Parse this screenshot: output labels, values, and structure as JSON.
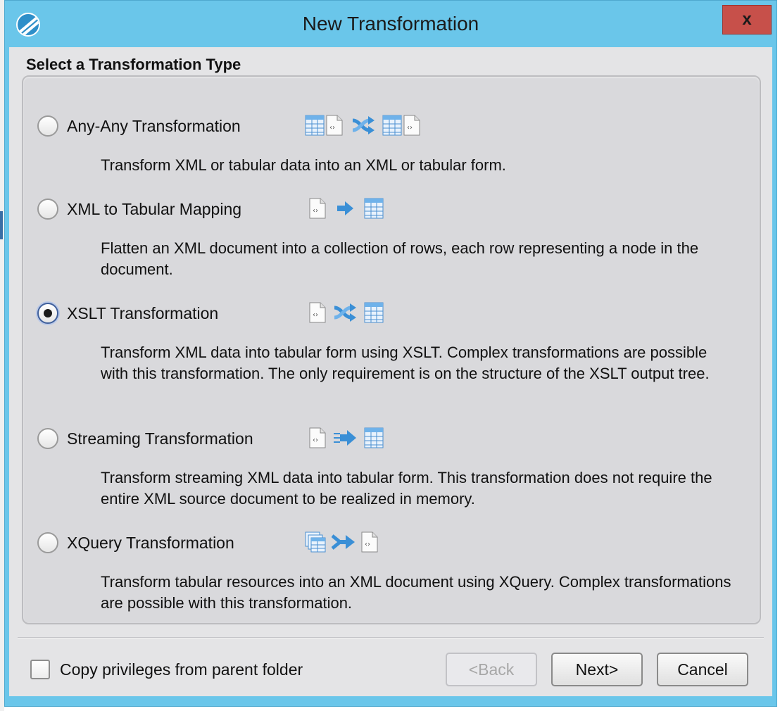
{
  "window": {
    "title": "New Transformation",
    "close_label": "x",
    "app_icon": "app-logo-icon"
  },
  "section": {
    "title": "Select a Transformation Type"
  },
  "options": [
    {
      "label": "Any-Any Transformation",
      "description": "Transform XML or tabular data into an XML or tabular form.",
      "selected": false,
      "icons": [
        "table-icon",
        "xml-document-icon",
        "shuffle-icon",
        "table-icon",
        "xml-document-icon"
      ]
    },
    {
      "label": "XML to Tabular Mapping",
      "description": "Flatten an XML document into a collection of rows, each row representing a node in the document.",
      "selected": false,
      "icons": [
        "xml-document-icon",
        "arrow-right-icon",
        "table-icon"
      ]
    },
    {
      "label": "XSLT Transformation",
      "description": "Transform XML data into tabular form using XSLT. Complex transformations are possible with this transformation. The only requirement is on the structure of the XSLT output tree.",
      "selected": true,
      "icons": [
        "xml-document-icon",
        "shuffle-icon",
        "table-icon"
      ]
    },
    {
      "label": "Streaming Transformation",
      "description": "Transform streaming XML data into tabular form. This transformation does not require the entire XML source document to be realized in memory.",
      "selected": false,
      "icons": [
        "xml-document-icon",
        "streaming-arrow-icon",
        "table-icon"
      ]
    },
    {
      "label": "XQuery Transformation",
      "description": "Transform tabular resources into an XML document using XQuery. Complex transformations are possible with this transformation.",
      "selected": false,
      "icons": [
        "stacked-tables-icon",
        "merge-arrow-icon",
        "xml-document-icon"
      ]
    }
  ],
  "footer": {
    "copy_privileges_label": "Copy privileges from parent folder",
    "copy_privileges_checked": false,
    "back_label": "<Back",
    "next_label": "Next>",
    "cancel_label": "Cancel"
  },
  "colors": {
    "titlebar": "#6ac6ea",
    "close_button": "#c7504a",
    "dialog_background": "#e4e4e6",
    "icon_blue": "#3a8fd6"
  }
}
